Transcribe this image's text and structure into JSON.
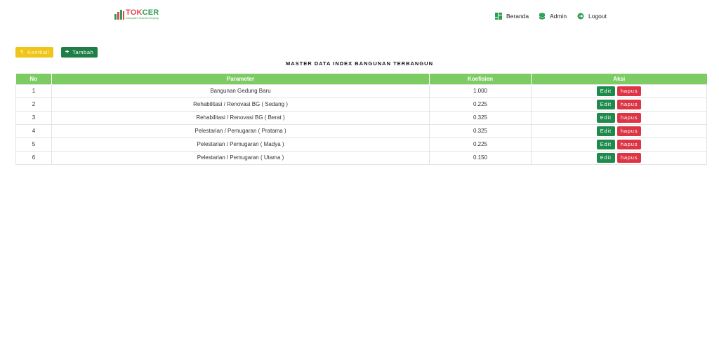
{
  "brand": {
    "title_prefix": "TOK",
    "title_suffix": "CER",
    "subtitle": "Kabupaten Kuantan Singingi",
    "colors": {
      "primary": "#e0484f",
      "secondary": "#2e9e52"
    }
  },
  "nav": {
    "items": [
      {
        "label": "Beranda",
        "icon": "dashboard-grid-icon"
      },
      {
        "label": "Admin",
        "icon": "database-icon"
      },
      {
        "label": "Logout",
        "icon": "logout-icon"
      }
    ]
  },
  "toolbar": {
    "back_label": "Kembali",
    "add_label": "Tambah",
    "back_icon": "back-arrow-icon",
    "add_icon": "plus-icon"
  },
  "page": {
    "title": "MASTER DATA INDEX BANGUNAN TERBANGUN"
  },
  "table": {
    "headers": [
      "No",
      "Parameter",
      "Koefisien",
      "Aksi"
    ],
    "rows": [
      {
        "no": "1",
        "parameter": "Bangunan Gedung Baru",
        "koefisien": "1.000",
        "edit": "Edit",
        "hapus": "hapus"
      },
      {
        "no": "2",
        "parameter": "Rehabilitasi / Renovasi BG ( Sedang )",
        "koefisien": "0.225",
        "edit": "Edit",
        "hapus": "hapus"
      },
      {
        "no": "3",
        "parameter": "Rehabilitasi / Renovasi BG ( Berat )",
        "koefisien": "0.325",
        "edit": "Edit",
        "hapus": "hapus"
      },
      {
        "no": "4",
        "parameter": "Pelestarian / Pemugaran ( Pratama )",
        "koefisien": "0.325",
        "edit": "Edit",
        "hapus": "hapus"
      },
      {
        "no": "5",
        "parameter": "Pelestarian / Pemugaran ( Madya )",
        "koefisien": "0.225",
        "edit": "Edit",
        "hapus": "hapus"
      },
      {
        "no": "6",
        "parameter": "Pelestarian / Pemugaran ( Utama )",
        "koefisien": "0.150",
        "edit": "Edit",
        "hapus": "hapus"
      }
    ]
  },
  "colors": {
    "header_bg": "#7ccc63",
    "edit": "#1e8a4c",
    "delete": "#dc3545",
    "back": "#f0c419",
    "add": "#1e7e45"
  }
}
